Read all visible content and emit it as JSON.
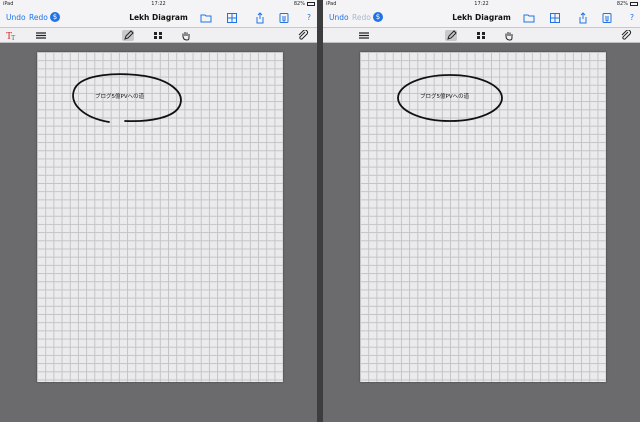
{
  "screens": [
    {
      "status": {
        "carrier": "iPad",
        "time": "17:22",
        "battery": "82%"
      },
      "nav": {
        "undo": "Undo",
        "redo": "Redo",
        "dollar": "$",
        "title": "Lekh Diagram",
        "help": "?"
      },
      "canvas": {
        "shape_text": "ブログ5億PVへの道",
        "shape": "open-freehand-ellipse"
      }
    },
    {
      "status": {
        "carrier": "iPad",
        "time": "17:22",
        "battery": "82%"
      },
      "nav": {
        "undo": "Undo",
        "redo": "Redo",
        "dollar": "$",
        "title": "Lekh Diagram",
        "help": "?"
      },
      "canvas": {
        "shape_text": "ブログ5億PVへの道",
        "shape": "ellipse"
      }
    }
  ],
  "colors": {
    "accent": "#1f73e6",
    "redo_disabled": "#a9b9cf",
    "paper": "#ebebed",
    "grid": "#c4c4c8",
    "background": "#6b6b6d"
  },
  "icons": [
    "folder-icon",
    "grid-settings-icon",
    "share-icon",
    "mail-attach-icon",
    "text-tool-icon",
    "line-style-icon",
    "pen-tool-icon",
    "grid-tool-icon",
    "hand-tool-icon",
    "paperclip-icon"
  ]
}
